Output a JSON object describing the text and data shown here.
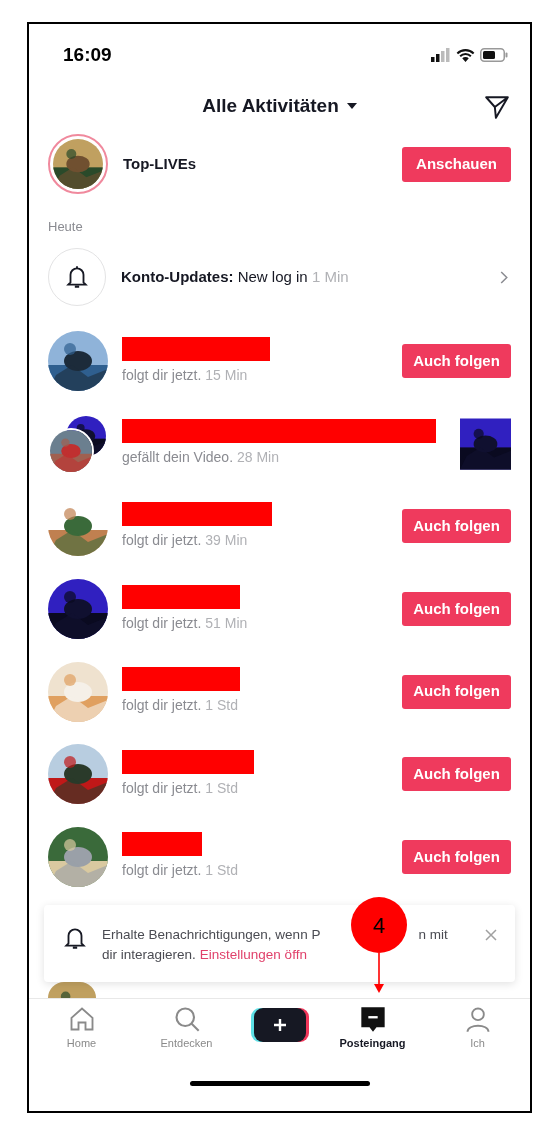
{
  "status_bar": {
    "time": "16:09"
  },
  "header": {
    "title": "Alle Aktivitäten"
  },
  "top_lives": {
    "label": "Top-LIVEs",
    "button": "Anschauen"
  },
  "section": "Heute",
  "account_update": {
    "label": "Konto-Updates:",
    "text": "New log in",
    "time": "1 Min"
  },
  "activities": [
    {
      "kind": "follow",
      "redacted": true,
      "text": "folgt dir jetzt.",
      "time": "15 Min",
      "button": "Auch folgen"
    },
    {
      "kind": "like",
      "redacted": true,
      "text": "gefällt dein Video.",
      "time": "28 Min"
    },
    {
      "kind": "follow",
      "redacted": true,
      "text": "folgt dir jetzt.",
      "time": "39 Min",
      "button": "Auch folgen"
    },
    {
      "kind": "follow",
      "redacted": true,
      "text": "folgt dir jetzt.",
      "time": "51 Min",
      "button": "Auch folgen"
    },
    {
      "kind": "follow",
      "redacted": true,
      "text": "folgt dir jetzt.",
      "time": "1 Std",
      "button": "Auch folgen"
    },
    {
      "kind": "follow",
      "redacted": true,
      "text": "folgt dir jetzt.",
      "time": "1 Std",
      "button": "Auch folgen"
    },
    {
      "kind": "follow",
      "redacted": true,
      "text": "folgt dir jetzt.",
      "time": "1 Std",
      "button": "Auch folgen"
    }
  ],
  "banner": {
    "line_1_start": "Erhalte Benachrichtigungen, wenn P",
    "line_1_end": "n mit",
    "line_2": "dir interagieren.",
    "link": "Einstellungen öffn"
  },
  "annotation": {
    "number": "4"
  },
  "tab_bar": [
    {
      "kind": "home",
      "label": "Home",
      "selected": false
    },
    {
      "kind": "search",
      "label": "Entdecken",
      "selected": false
    },
    {
      "kind": "create",
      "selected": false
    },
    {
      "kind": "inbox",
      "label": "Posteingang",
      "selected": true
    },
    {
      "kind": "profile",
      "label": "Ich",
      "selected": false
    }
  ]
}
